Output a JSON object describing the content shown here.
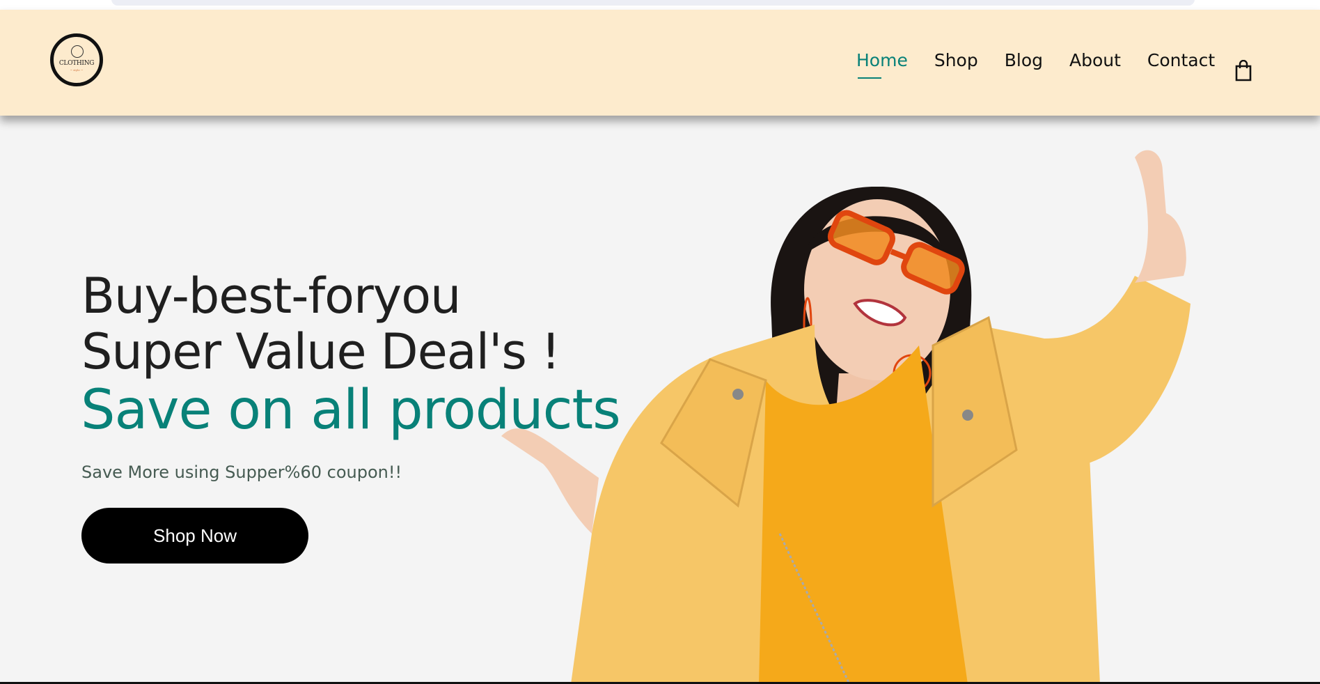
{
  "brand": {
    "logo_text": "CLOTHING",
    "logo_subtext": "~ style ~"
  },
  "nav": {
    "items": [
      {
        "label": "Home",
        "active": true
      },
      {
        "label": "Shop",
        "active": false
      },
      {
        "label": "Blog",
        "active": false
      },
      {
        "label": "About",
        "active": false
      },
      {
        "label": "Contact",
        "active": false
      }
    ],
    "cart_icon": "shopping-bag-icon"
  },
  "hero": {
    "line1": "Buy-best-foryou",
    "line2": "Super Value Deal's !",
    "accent": "Save on all products",
    "coupon_text": "Save More using Supper%60 coupon!!",
    "cta_label": "Shop Now",
    "image_alt": "Smiling woman in orange sunglasses and yellow jacket pointing"
  },
  "colors": {
    "header_bg": "#fdebcd",
    "accent": "#088178",
    "text": "#1f1f1f",
    "button_bg": "#000000"
  }
}
